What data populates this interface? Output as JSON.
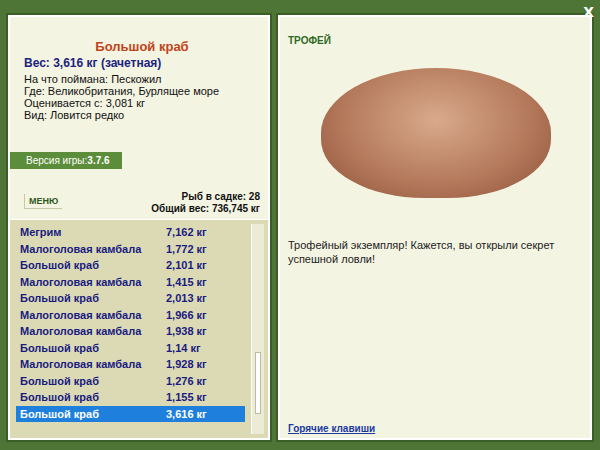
{
  "close": "X",
  "fish": {
    "title": "Большой краб",
    "weight": "Вес: 3,616 кг (зачетная)",
    "details": [
      "На что поймана: Пескожил",
      "Где: Великобритания, Бурлящее море",
      "Оценивается с: 3,081 кг",
      "Вид: Ловится редко"
    ]
  },
  "version": {
    "label": "Версия игры:",
    "value": "3.7.6"
  },
  "menu": "МЕНЮ",
  "stats": [
    "Рыб в садке: 28",
    "Общий вес: 736,745 кг"
  ],
  "catches": [
    {
      "name": "Мегрим",
      "weight": "7,162 кг",
      "selected": false
    },
    {
      "name": "Малоголовая камбала",
      "weight": "1,772 кг",
      "selected": false
    },
    {
      "name": "Большой краб",
      "weight": "2,101 кг",
      "selected": false
    },
    {
      "name": "Малоголовая камбала",
      "weight": "1,415 кг",
      "selected": false
    },
    {
      "name": "Большой краб",
      "weight": "2,013 кг",
      "selected": false
    },
    {
      "name": "Малоголовая камбала",
      "weight": "1,966 кг",
      "selected": false
    },
    {
      "name": "Малоголовая камбала",
      "weight": "1,938 кг",
      "selected": false
    },
    {
      "name": "Большой краб",
      "weight": "1,14 кг",
      "selected": false
    },
    {
      "name": "Малоголовая камбала",
      "weight": "1,928 кг",
      "selected": false
    },
    {
      "name": "Большой краб",
      "weight": "1,276 кг",
      "selected": false
    },
    {
      "name": "Большой краб",
      "weight": "1,155 кг",
      "selected": false
    },
    {
      "name": "Большой краб",
      "weight": "3,616 кг",
      "selected": true
    }
  ],
  "scrollbar": {
    "level": 0.85
  },
  "trophy": {
    "label": "ТРОФЕЙ",
    "message": "Трофейный экземпляр! Кажется, вы открыли секрет успешной ловли!"
  },
  "hotkeys": "Горячие клавиши"
}
